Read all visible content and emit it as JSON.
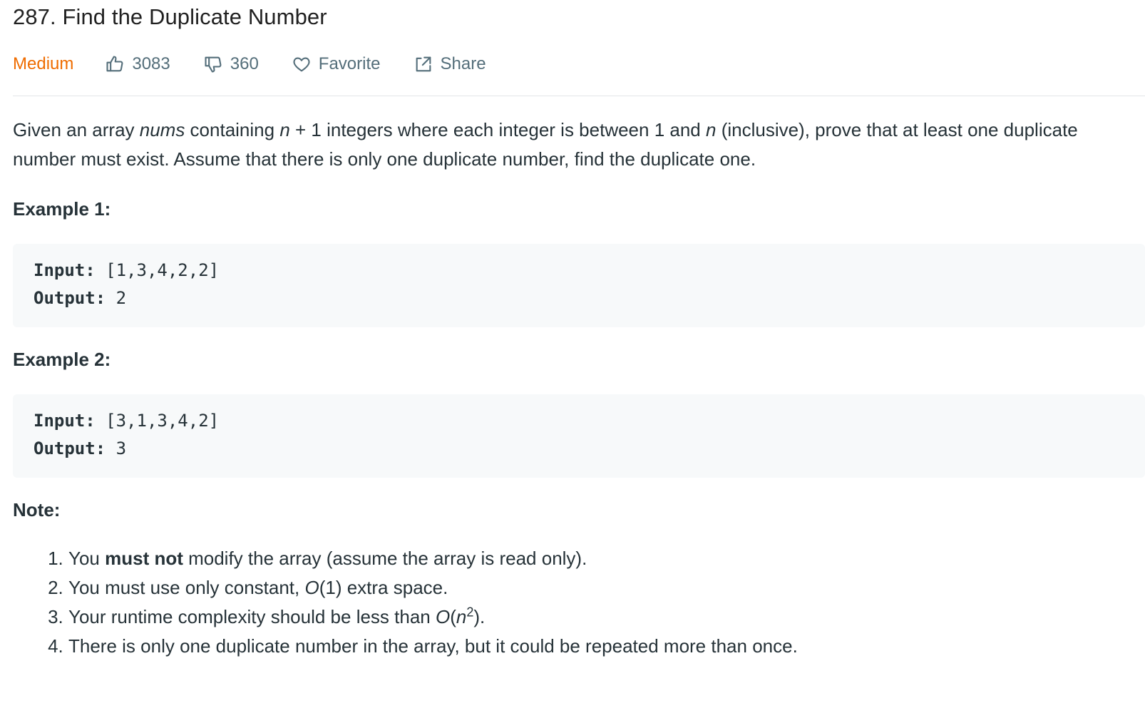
{
  "problem": {
    "title": "287. Find the Duplicate Number",
    "difficulty": "Medium",
    "likes": "3083",
    "dislikes": "360",
    "favorite_label": "Favorite",
    "share_label": "Share"
  },
  "description": {
    "p1": "Given an array ",
    "nums": "nums",
    "p2": " containing ",
    "n1": "n",
    "p3": " + 1 integers where each integer is between 1 and ",
    "n2": "n",
    "p4": " (inclusive), prove that at least one duplicate number must exist. Assume that there is only one duplicate number, find the duplicate one."
  },
  "examples": [
    {
      "heading": "Example 1:",
      "input_label": "Input:",
      "input_value": " [1,3,4,2,2]",
      "output_label": "Output:",
      "output_value": " 2"
    },
    {
      "heading": "Example 2:",
      "input_label": "Input:",
      "input_value": " [3,1,3,4,2]",
      "output_label": "Output:",
      "output_value": " 3"
    }
  ],
  "note": {
    "heading": "Note:",
    "item1_a": "You ",
    "item1_b": "must not",
    "item1_c": " modify the array (assume the array is read only).",
    "item2_a": "You must use only constant, ",
    "item2_o": "O",
    "item2_b": "(1) extra space.",
    "item3_a": "Your runtime complexity should be less than ",
    "item3_o": "O",
    "item3_paren": "(",
    "item3_n": "n",
    "item3_sup": "2",
    "item3_b": ").",
    "item4": "There is only one duplicate number in the array, but it could be repeated more than once."
  },
  "colors": {
    "difficulty_medium": "#ef6c00",
    "meta_text": "#546e7a",
    "code_background": "#f7f9fa"
  },
  "icons": {
    "likes": "thumbs-up-icon",
    "dislikes": "thumbs-down-icon",
    "favorite": "heart-icon",
    "share": "share-icon"
  }
}
